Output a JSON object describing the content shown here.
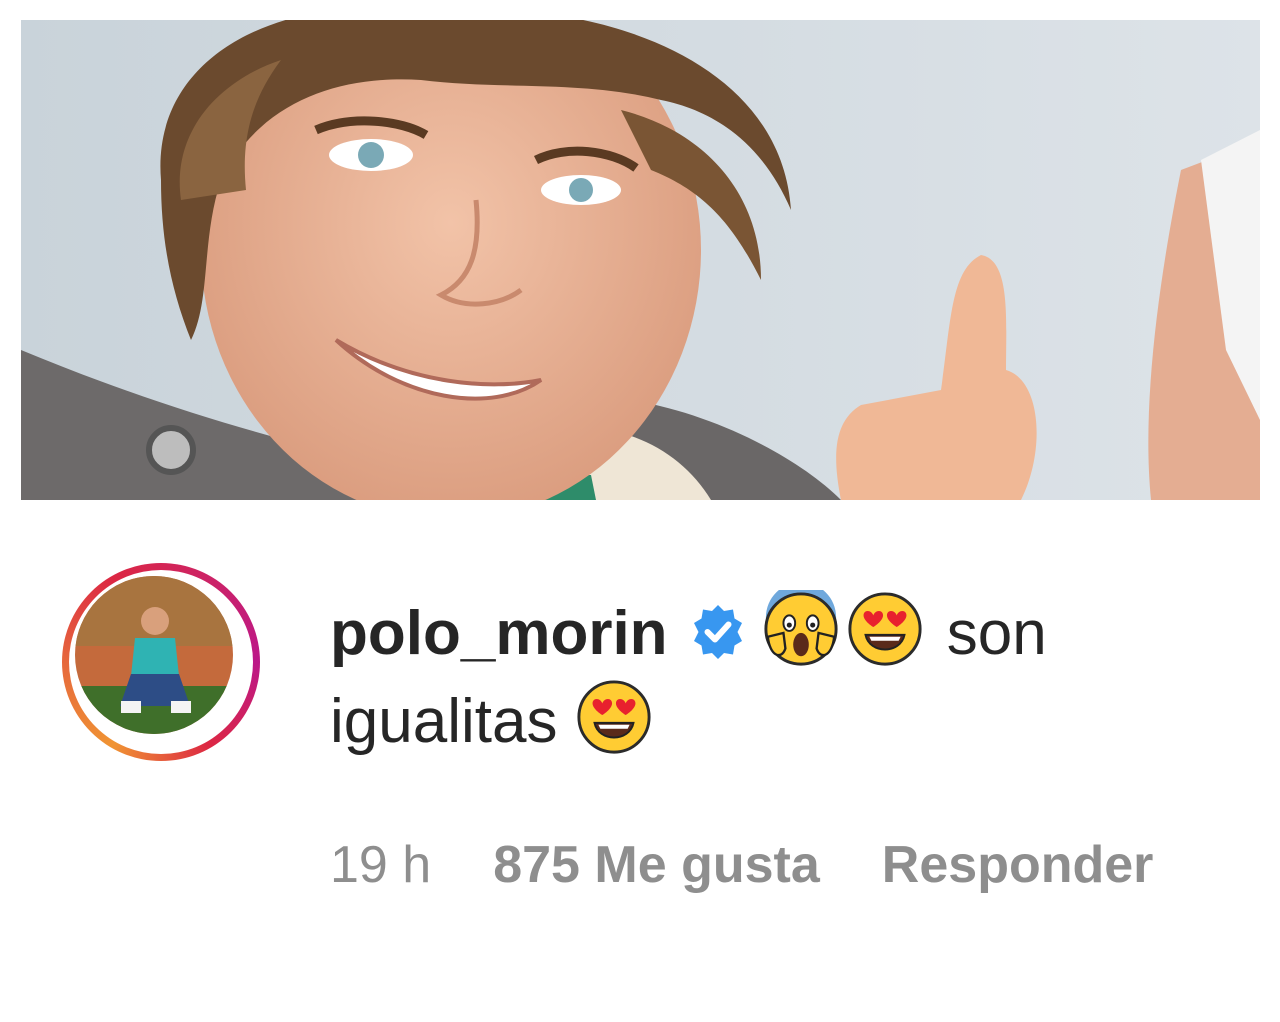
{
  "post_photo": {
    "description_icon": "selfie-photo"
  },
  "comment": {
    "username": "polo_morin",
    "verified_icon": "verified-badge-icon",
    "emojis_line1": [
      "face-screaming-in-fear-emoji",
      "smiling-face-with-heart-eyes-emoji"
    ],
    "text_part1": "son",
    "text_part2": "igualitas",
    "emojis_line2": [
      "smiling-face-with-heart-eyes-emoji"
    ]
  },
  "meta": {
    "time": "19 h",
    "likes": "875 Me gusta",
    "reply": "Responder"
  },
  "colors": {
    "text": "#262626",
    "muted": "#8e8e8e",
    "verified": "#3897f0"
  }
}
